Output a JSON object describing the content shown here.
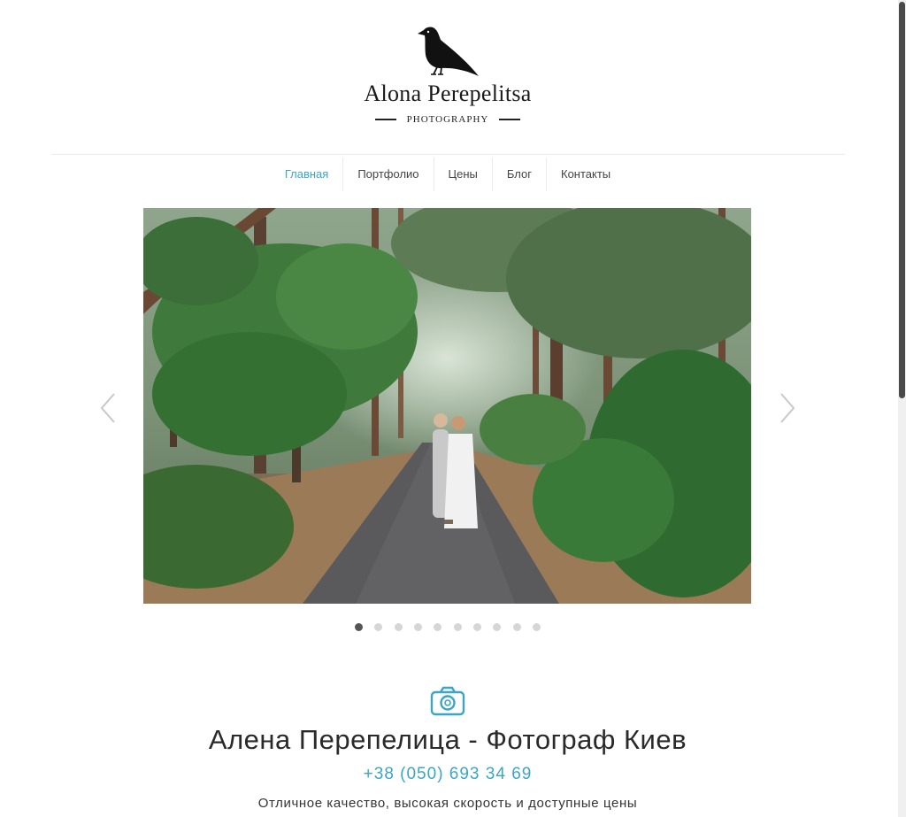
{
  "logo": {
    "name": "Alona Perepelitsa",
    "subtitle": "PHOTOGRAPHY",
    "icon": "bird-icon"
  },
  "nav": {
    "items": [
      {
        "label": "Главная",
        "active": true
      },
      {
        "label": "Портфолио",
        "active": false
      },
      {
        "label": "Цены",
        "active": false
      },
      {
        "label": "Блог",
        "active": false
      },
      {
        "label": "Контакты",
        "active": false
      }
    ]
  },
  "slider": {
    "prev_icon": "chevron-left-icon",
    "next_icon": "chevron-right-icon",
    "slide_count": 10,
    "active_slide": 1
  },
  "hero": {
    "icon": "camera-icon",
    "headline": "Алена Перепелица - Фотограф Киев",
    "phone": "+38 (050) 693 34 69",
    "tagline": "Отличное качество, высокая скорость и доступные цены"
  },
  "colors": {
    "accent": "#3aa6c6",
    "text": "#2a2a2a"
  }
}
